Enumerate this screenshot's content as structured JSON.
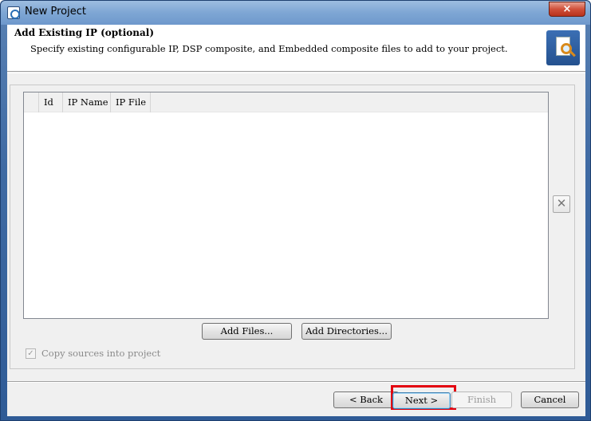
{
  "window": {
    "title": "New Project",
    "close_glyph": "×"
  },
  "header": {
    "title": "Add Existing IP (optional)",
    "description": "Specify existing configurable IP, DSP composite, and Embedded composite files to add to your project.",
    "icon": "add-ip-document-search-icon"
  },
  "table": {
    "columns": [
      "",
      "Id",
      "IP Name",
      "IP File"
    ],
    "rows": []
  },
  "actions": {
    "remove_glyph": "✕",
    "add_files": "Add Files...",
    "add_directories": "Add Directories..."
  },
  "options": {
    "copy_sources_label": "Copy sources into project",
    "copy_sources_checked": true,
    "check_glyph": "✓"
  },
  "footer": {
    "back": "< Back",
    "next": "Next >",
    "finish": "Finish",
    "cancel": "Cancel"
  },
  "colors": {
    "highlight_box": "#e3000f",
    "title_bar": "#7ea6d4"
  }
}
